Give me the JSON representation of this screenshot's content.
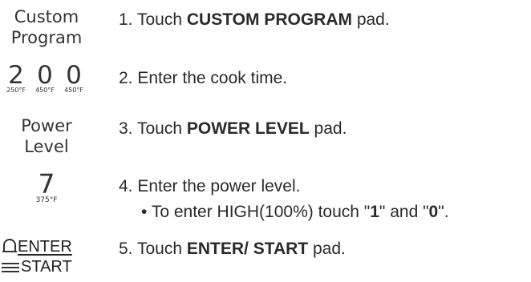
{
  "rows": [
    {
      "pad": [
        "Custom",
        "Program"
      ],
      "number": "1.",
      "pre": "Touch ",
      "bold": "CUSTOM PROGRAM",
      "post": " pad."
    },
    {
      "pad_digits": [
        {
          "digit": "2",
          "temp": "250°F"
        },
        {
          "digit": "0",
          "temp": "450°F"
        },
        {
          "digit": "0",
          "temp": "450°F"
        }
      ],
      "number": "2.",
      "text": "Enter the cook time."
    },
    {
      "pad": [
        "Power",
        "Level"
      ],
      "number": "3.",
      "pre": "Touch ",
      "bold": "POWER LEVEL",
      "post": " pad."
    },
    {
      "pad_digit": {
        "digit": "7",
        "temp": "375°F"
      },
      "number": "4.",
      "text": "Enter the power level.",
      "bullet": {
        "mark": "•",
        "pre": "To enter HIGH(100%) touch \"",
        "bold1": "1",
        "mid": "\" and \"",
        "bold2": "0",
        "post": "\"."
      }
    },
    {
      "pad_enter": {
        "top": "ENTER",
        "bottom": "START",
        "icon": "door-icon"
      },
      "number": "5.",
      "pre": "Touch ",
      "bold": "ENTER/ START",
      "post": " pad."
    }
  ]
}
